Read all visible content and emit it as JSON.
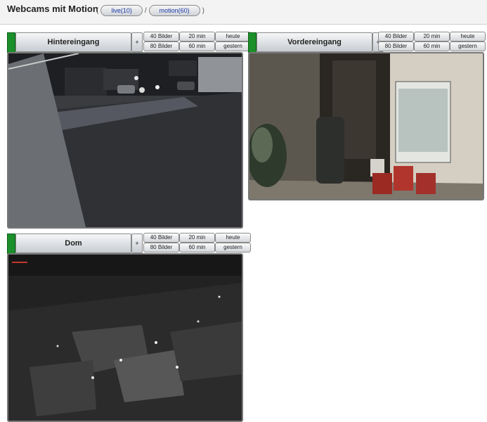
{
  "header": {
    "title": "Webcams mit Motion",
    "links_open": "(",
    "live_label": "live(10)",
    "separator": "/",
    "motion_label": "motion(60)",
    "links_close": ")"
  },
  "cameras": [
    {
      "name": "Hintereingang",
      "status_color": "#1b8f2a",
      "plus": "+",
      "btn_40": "40 Bilder",
      "btn_80": "80 Bilder",
      "btn_20min": "20 min",
      "btn_60min": "60 min",
      "btn_heute": "heute",
      "btn_gestern": "gestern"
    },
    {
      "name": "Vordereingang",
      "status_color": "#1b8f2a",
      "plus": "+",
      "btn_40": "40 Bilder",
      "btn_80": "80 Bilder",
      "btn_20min": "20 min",
      "btn_60min": "60 min",
      "btn_heute": "heute",
      "btn_gestern": "gestern"
    },
    {
      "name": "Dom",
      "status_color": "#1b8f2a",
      "plus": "+",
      "btn_40": "40 Bilder",
      "btn_80": "80 Bilder",
      "btn_20min": "20 min",
      "btn_60min": "60 min",
      "btn_heute": "heute",
      "btn_gestern": "gestern"
    }
  ]
}
